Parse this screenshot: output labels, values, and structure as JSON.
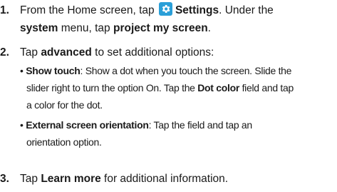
{
  "steps": [
    {
      "num": "1.",
      "l1_pre": "From the Home screen, tap ",
      "l1_bold": "Settings",
      "l1_post": ". Under the",
      "l2_bold1": "system",
      "l2_mid": " menu, tap ",
      "l2_bold2": "project my screen",
      "l2_post": "."
    },
    {
      "num": "2.",
      "pre": "Tap ",
      "bold": "advanced",
      "post": " to set additional options:"
    },
    {
      "num": "3.",
      "pre": "Tap ",
      "bold": "Learn more",
      "post": " for additional information."
    }
  ],
  "options": [
    {
      "bullet": "•",
      "name": "Show touch",
      "r1_post": ": Show a dot when you touch the screen. Slide the",
      "r2_pre": "slider right to turn the option On. Tap the ",
      "r2_bold": "Dot color",
      "r2_post": " field and tap",
      "r3": "a color for the dot."
    },
    {
      "bullet": "•",
      "name": "External screen orientation",
      "r1_post": ": Tap the field and tap an",
      "r2": "orientation option."
    }
  ],
  "icons": {
    "settings": "gear-icon",
    "settings_color": "#2a9fd8"
  }
}
